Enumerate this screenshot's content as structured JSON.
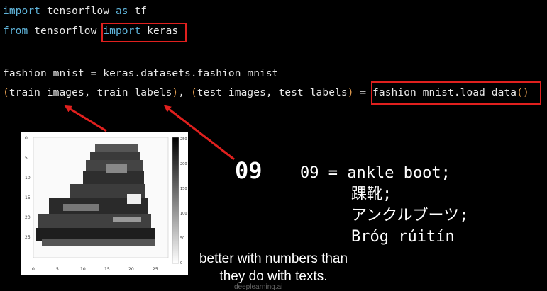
{
  "code": {
    "line1": {
      "kw1": "import",
      "rest": " tensorflow ",
      "kw2": "as",
      "tail": " tf"
    },
    "line2": {
      "kw1": "from",
      "rest": " tensorflow ",
      "kw2": "import",
      "tail": " keras"
    },
    "line3": "fashion_mnist = keras.datasets.fashion_mnist",
    "line4": {
      "paren_open": "(",
      "a": "train_images, train_labels",
      "paren_close": ")",
      "mid": ", ",
      "paren_open2": "(",
      "b": "test_images, test_labels",
      "paren_close2": ")",
      "eq": " = ",
      "call": "fashion_mnist.load_data",
      "call_parens": "()"
    }
  },
  "figure": {
    "y_ticks": [
      "0",
      "5",
      "10",
      "15",
      "20",
      "25"
    ],
    "x_ticks": [
      "0",
      "5",
      "10",
      "15",
      "20",
      "25"
    ],
    "colorbar_ticks": [
      "250",
      "200",
      "150",
      "100",
      "50",
      "0"
    ]
  },
  "label_number": "09",
  "translations": [
    "09 = ankle boot;",
    "踝靴;",
    "アンクルブーツ;",
    "Bróg rúitín"
  ],
  "subtitles": [
    "better with numbers than",
    "they do with texts."
  ],
  "watermark": "deeplearning.ai",
  "colors": {
    "highlight": "#e0201e",
    "keyword": "#5fb3d9",
    "paren": "#e09a4e"
  }
}
